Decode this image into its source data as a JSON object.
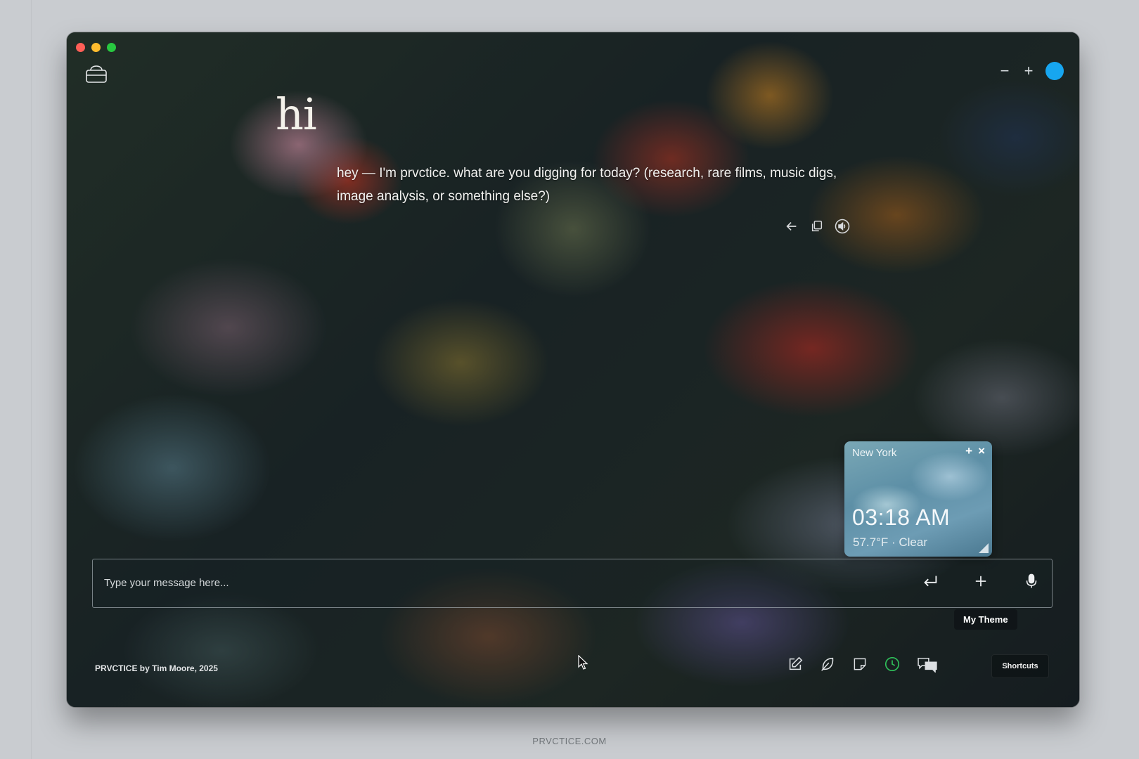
{
  "window": {
    "traffic_lights": [
      "close",
      "minimize",
      "zoom"
    ],
    "top_right": {
      "minus_label": "−",
      "plus_label": "+",
      "status_color": "#17a6f0"
    }
  },
  "chat": {
    "greeting": "hi",
    "assistant_message": "hey — I'm prvctice. what are you digging for today? (research, rare films, music digs, image analysis, or something else?)",
    "message_actions": [
      "back-arrow-icon",
      "copy-icon",
      "speaker-icon"
    ]
  },
  "clock_widget": {
    "city": "New York",
    "add_label": "+",
    "close_label": "×",
    "time": "03:18 AM",
    "weather": "57.7°F · Clear"
  },
  "composer": {
    "placeholder": "Type your message here...",
    "actions": [
      "enter-icon",
      "plus-icon",
      "mic-icon"
    ]
  },
  "tooltip": {
    "label": "My Theme"
  },
  "footer": {
    "credit": "PRVCTICE by Tim Moore, 2025",
    "tools": [
      "edit-icon",
      "feather-icon",
      "note-icon",
      "clock-icon",
      "chat-bubbles-icon"
    ],
    "shortcuts_label": "Shortcuts",
    "clock_icon_color": "#2fbf5a"
  },
  "site": {
    "domain": "PRVCTICE.COM"
  }
}
